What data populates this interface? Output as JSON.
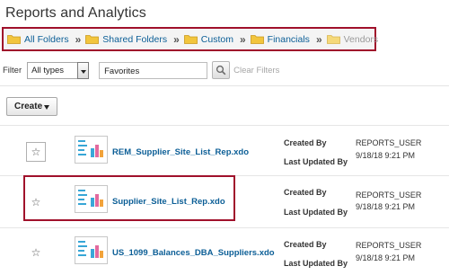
{
  "page": {
    "title": "Reports and Analytics"
  },
  "breadcrumb": [
    {
      "label": "All Folders",
      "active": true
    },
    {
      "label": "Shared Folders",
      "active": true
    },
    {
      "label": "Custom",
      "active": true
    },
    {
      "label": "Financials",
      "active": true
    },
    {
      "label": "Vendors",
      "active": false
    }
  ],
  "breadcrumb_separator": "»",
  "filter": {
    "label": "Filter",
    "type_value": "All types",
    "search_value": "Favorites",
    "clear_label": "Clear Filters"
  },
  "toolbar": {
    "create_label": "Create"
  },
  "colors": {
    "accent": "#a0112b",
    "link": "#0b5e96",
    "folder": "#f2c53d"
  },
  "reports": [
    {
      "name": "REM_Supplier_Site_List_Rep.xdo",
      "created_label": "Created By",
      "created_by": "REPORTS_USER",
      "updated_label": "Last Updated By",
      "updated": "9/18/18 9:21 PM"
    },
    {
      "name": "Supplier_Site_List_Rep.xdo",
      "created_label": "Created By",
      "created_by": "REPORTS_USER",
      "updated_label": "Last Updated By",
      "updated": "9/18/18 9:21 PM"
    },
    {
      "name": "US_1099_Balances_DBA_Suppliers.xdo",
      "created_label": "Created By",
      "created_by": "REPORTS_USER",
      "updated_label": "Last Updated By",
      "updated": "9/18/18 9:21 PM"
    }
  ]
}
